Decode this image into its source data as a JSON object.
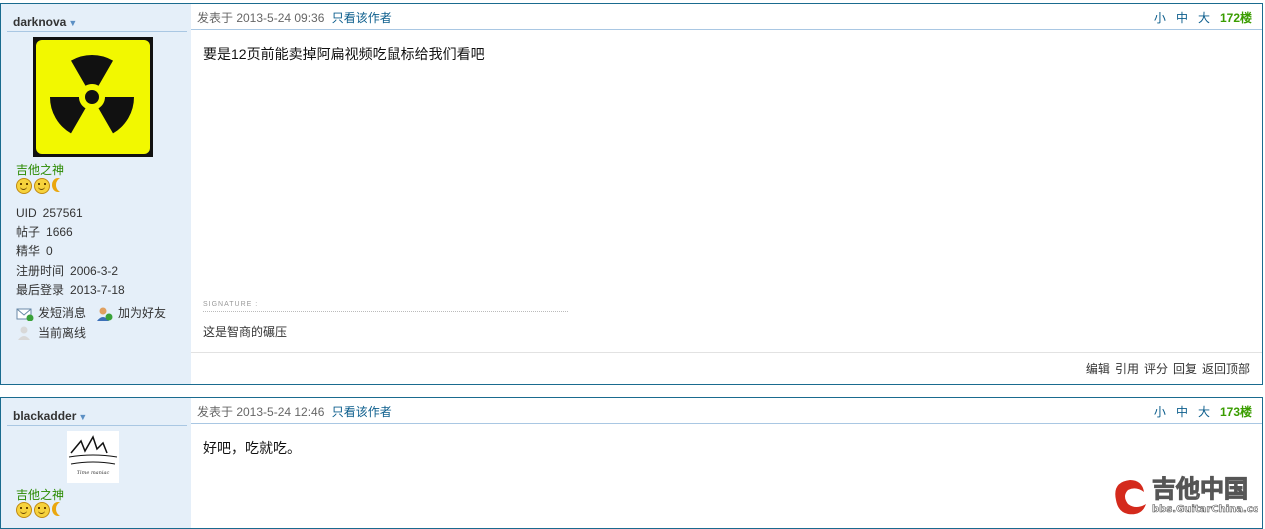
{
  "posts": [
    {
      "author": "darknova",
      "rank": "吉他之神",
      "stats": [
        {
          "label": "UID",
          "value": "257561"
        },
        {
          "label": "帖子",
          "value": "1666"
        },
        {
          "label": "精华",
          "value": "0"
        },
        {
          "label": "注册时间",
          "value": "2006-3-2"
        },
        {
          "label": "最后登录",
          "value": "2013-7-18"
        }
      ],
      "actions": {
        "message": "发短消息",
        "add_friend": "加为好友",
        "status": "当前离线"
      },
      "date": "发表于 2013-5-24 09:36",
      "only_author": "只看该作者",
      "sizes": [
        "小",
        "中",
        "大"
      ],
      "floor": "172楼",
      "content": "要是12页前能卖掉阿扁视频吃鼠标给我们看吧",
      "signature_label": "SIGNATURE :",
      "signature": "这是智商的碾压",
      "footer": [
        "编辑",
        "引用",
        "评分",
        "回复",
        "返回顶部"
      ]
    },
    {
      "author": "blackadder",
      "rank": "吉他之神",
      "date": "发表于 2013-5-24 12:46",
      "only_author": "只看该作者",
      "sizes": [
        "小",
        "中",
        "大"
      ],
      "floor": "173楼",
      "content": "好吧，吃就吃。",
      "avatar_text": "Time maniac"
    }
  ],
  "watermark": {
    "title": "吉他中国",
    "url": "bbs.GuitarChina.com"
  },
  "colors": {
    "sidebar": "#e5eff9",
    "border": "#1a6b8f",
    "rank": "#2a8a00",
    "floor": "#3a9d00",
    "link": "#0b5d8c"
  }
}
